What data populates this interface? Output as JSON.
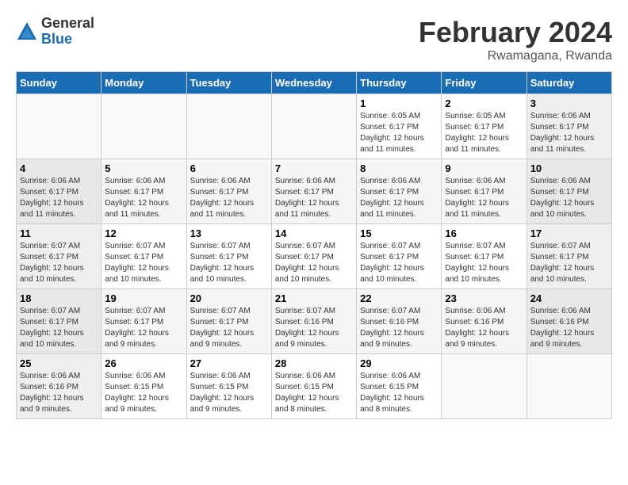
{
  "logo": {
    "general": "General",
    "blue": "Blue"
  },
  "title": "February 2024",
  "location": "Rwamagana, Rwanda",
  "days_of_week": [
    "Sunday",
    "Monday",
    "Tuesday",
    "Wednesday",
    "Thursday",
    "Friday",
    "Saturday"
  ],
  "weeks": [
    [
      {
        "day": "",
        "info": ""
      },
      {
        "day": "",
        "info": ""
      },
      {
        "day": "",
        "info": ""
      },
      {
        "day": "",
        "info": ""
      },
      {
        "day": "1",
        "info": "Sunrise: 6:05 AM\nSunset: 6:17 PM\nDaylight: 12 hours\nand 11 minutes."
      },
      {
        "day": "2",
        "info": "Sunrise: 6:05 AM\nSunset: 6:17 PM\nDaylight: 12 hours\nand 11 minutes."
      },
      {
        "day": "3",
        "info": "Sunrise: 6:06 AM\nSunset: 6:17 PM\nDaylight: 12 hours\nand 11 minutes."
      }
    ],
    [
      {
        "day": "4",
        "info": "Sunrise: 6:06 AM\nSunset: 6:17 PM\nDaylight: 12 hours\nand 11 minutes."
      },
      {
        "day": "5",
        "info": "Sunrise: 6:06 AM\nSunset: 6:17 PM\nDaylight: 12 hours\nand 11 minutes."
      },
      {
        "day": "6",
        "info": "Sunrise: 6:06 AM\nSunset: 6:17 PM\nDaylight: 12 hours\nand 11 minutes."
      },
      {
        "day": "7",
        "info": "Sunrise: 6:06 AM\nSunset: 6:17 PM\nDaylight: 12 hours\nand 11 minutes."
      },
      {
        "day": "8",
        "info": "Sunrise: 6:06 AM\nSunset: 6:17 PM\nDaylight: 12 hours\nand 11 minutes."
      },
      {
        "day": "9",
        "info": "Sunrise: 6:06 AM\nSunset: 6:17 PM\nDaylight: 12 hours\nand 11 minutes."
      },
      {
        "day": "10",
        "info": "Sunrise: 6:06 AM\nSunset: 6:17 PM\nDaylight: 12 hours\nand 10 minutes."
      }
    ],
    [
      {
        "day": "11",
        "info": "Sunrise: 6:07 AM\nSunset: 6:17 PM\nDaylight: 12 hours\nand 10 minutes."
      },
      {
        "day": "12",
        "info": "Sunrise: 6:07 AM\nSunset: 6:17 PM\nDaylight: 12 hours\nand 10 minutes."
      },
      {
        "day": "13",
        "info": "Sunrise: 6:07 AM\nSunset: 6:17 PM\nDaylight: 12 hours\nand 10 minutes."
      },
      {
        "day": "14",
        "info": "Sunrise: 6:07 AM\nSunset: 6:17 PM\nDaylight: 12 hours\nand 10 minutes."
      },
      {
        "day": "15",
        "info": "Sunrise: 6:07 AM\nSunset: 6:17 PM\nDaylight: 12 hours\nand 10 minutes."
      },
      {
        "day": "16",
        "info": "Sunrise: 6:07 AM\nSunset: 6:17 PM\nDaylight: 12 hours\nand 10 minutes."
      },
      {
        "day": "17",
        "info": "Sunrise: 6:07 AM\nSunset: 6:17 PM\nDaylight: 12 hours\nand 10 minutes."
      }
    ],
    [
      {
        "day": "18",
        "info": "Sunrise: 6:07 AM\nSunset: 6:17 PM\nDaylight: 12 hours\nand 10 minutes."
      },
      {
        "day": "19",
        "info": "Sunrise: 6:07 AM\nSunset: 6:17 PM\nDaylight: 12 hours\nand 9 minutes."
      },
      {
        "day": "20",
        "info": "Sunrise: 6:07 AM\nSunset: 6:17 PM\nDaylight: 12 hours\nand 9 minutes."
      },
      {
        "day": "21",
        "info": "Sunrise: 6:07 AM\nSunset: 6:16 PM\nDaylight: 12 hours\nand 9 minutes."
      },
      {
        "day": "22",
        "info": "Sunrise: 6:07 AM\nSunset: 6:16 PM\nDaylight: 12 hours\nand 9 minutes."
      },
      {
        "day": "23",
        "info": "Sunrise: 6:06 AM\nSunset: 6:16 PM\nDaylight: 12 hours\nand 9 minutes."
      },
      {
        "day": "24",
        "info": "Sunrise: 6:06 AM\nSunset: 6:16 PM\nDaylight: 12 hours\nand 9 minutes."
      }
    ],
    [
      {
        "day": "25",
        "info": "Sunrise: 6:06 AM\nSunset: 6:16 PM\nDaylight: 12 hours\nand 9 minutes."
      },
      {
        "day": "26",
        "info": "Sunrise: 6:06 AM\nSunset: 6:15 PM\nDaylight: 12 hours\nand 9 minutes."
      },
      {
        "day": "27",
        "info": "Sunrise: 6:06 AM\nSunset: 6:15 PM\nDaylight: 12 hours\nand 9 minutes."
      },
      {
        "day": "28",
        "info": "Sunrise: 6:06 AM\nSunset: 6:15 PM\nDaylight: 12 hours\nand 8 minutes."
      },
      {
        "day": "29",
        "info": "Sunrise: 6:06 AM\nSunset: 6:15 PM\nDaylight: 12 hours\nand 8 minutes."
      },
      {
        "day": "",
        "info": ""
      },
      {
        "day": "",
        "info": ""
      }
    ]
  ]
}
